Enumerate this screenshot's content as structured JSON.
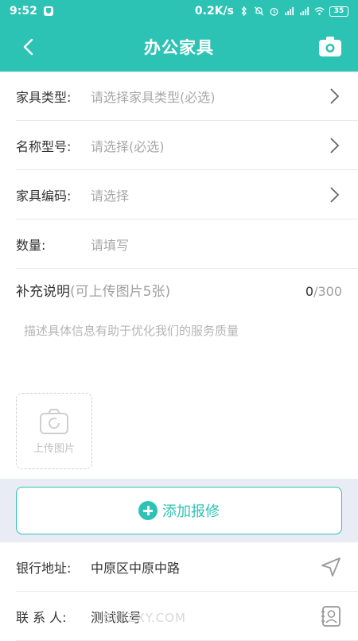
{
  "status_bar": {
    "time": "9:52",
    "network_speed": "0.2K/s",
    "battery": "35"
  },
  "header": {
    "title": "办公家具"
  },
  "form": {
    "rows": [
      {
        "label": "家具类型:",
        "placeholder": "请选择家具类型(必选)"
      },
      {
        "label": "名称型号:",
        "placeholder": "请选择(必选)"
      },
      {
        "label": "家具编码:",
        "placeholder": "请选择"
      },
      {
        "label": "数量:",
        "placeholder": "请填写"
      }
    ]
  },
  "supplement": {
    "title": "补充说明",
    "hint": "(可上传图片5张)",
    "count_current": "0",
    "count_max": "/300",
    "placeholder": "描述具体信息有助于优化我们的服务质量"
  },
  "upload": {
    "label": "上传图片"
  },
  "add_button": {
    "label": "添加报修"
  },
  "contact": {
    "address_label": "银行地址:",
    "address_value": "中原区中原中路",
    "person_label": "联 系 人:",
    "person_value": "测试账号"
  },
  "watermark": "BYFZXY.COM",
  "colors": {
    "accent": "#2dc3b4",
    "band": "#e9ecf4"
  }
}
